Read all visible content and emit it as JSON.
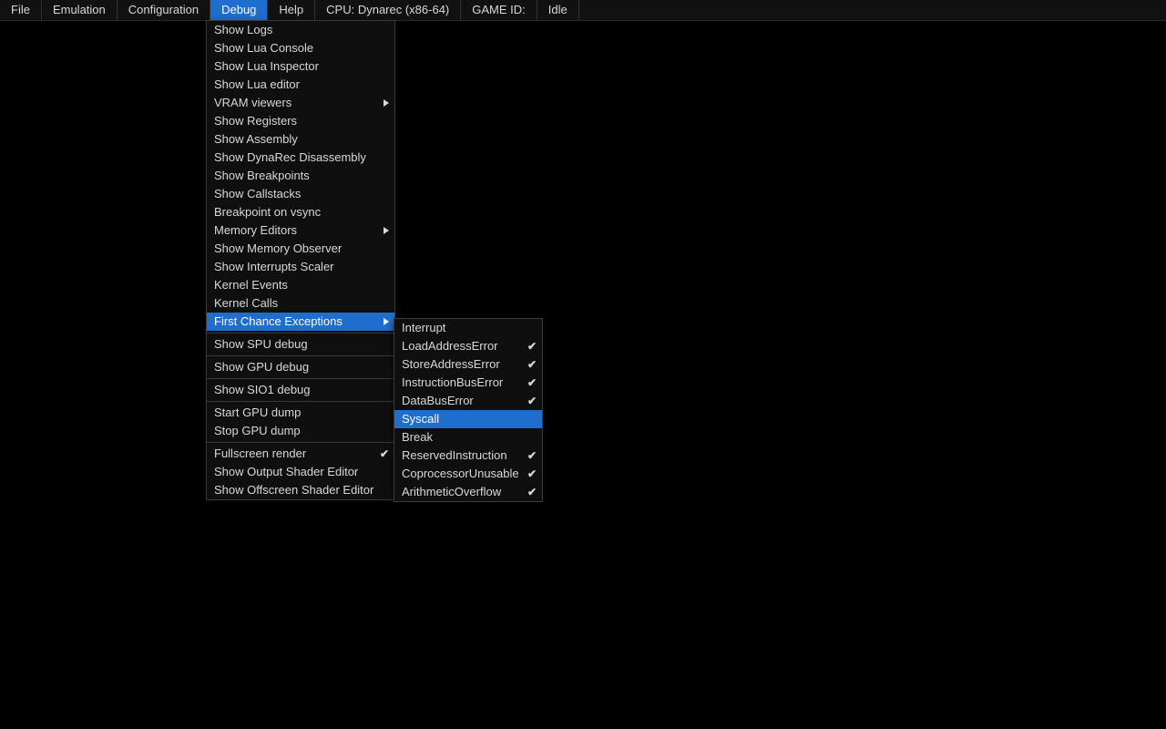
{
  "menubar": {
    "file": "File",
    "emulation": "Emulation",
    "configuration": "Configuration",
    "debug": "Debug",
    "help": "Help",
    "cpu_status": "CPU: Dynarec (x86-64)",
    "game_id_label": "GAME ID:",
    "idle_status": "Idle"
  },
  "debug_menu": {
    "groups": [
      [
        {
          "label": "Show Logs"
        },
        {
          "label": "Show Lua Console"
        },
        {
          "label": "Show Lua Inspector"
        },
        {
          "label": "Show Lua editor"
        },
        {
          "label": "VRAM viewers",
          "submenu": true
        },
        {
          "label": "Show Registers"
        },
        {
          "label": "Show Assembly"
        },
        {
          "label": "Show DynaRec Disassembly"
        },
        {
          "label": "Show Breakpoints"
        },
        {
          "label": "Show Callstacks"
        },
        {
          "label": "Breakpoint on vsync"
        },
        {
          "label": "Memory Editors",
          "submenu": true
        },
        {
          "label": "Show Memory Observer"
        },
        {
          "label": "Show Interrupts Scaler"
        },
        {
          "label": "Kernel Events"
        },
        {
          "label": "Kernel Calls"
        },
        {
          "label": "First Chance Exceptions",
          "submenu": true,
          "highlight": true
        }
      ],
      [
        {
          "label": "Show SPU debug"
        }
      ],
      [
        {
          "label": "Show GPU debug"
        }
      ],
      [
        {
          "label": "Show SIO1 debug"
        }
      ],
      [
        {
          "label": "Start GPU dump"
        },
        {
          "label": "Stop GPU dump"
        }
      ],
      [
        {
          "label": "Fullscreen render",
          "checked": true
        },
        {
          "label": "Show Output Shader Editor"
        },
        {
          "label": "Show Offscreen Shader Editor"
        }
      ]
    ]
  },
  "submenu": {
    "items": [
      {
        "label": "Interrupt"
      },
      {
        "label": "LoadAddressError",
        "checked": true
      },
      {
        "label": "StoreAddressError",
        "checked": true
      },
      {
        "label": "InstructionBusError",
        "checked": true
      },
      {
        "label": "DataBusError",
        "checked": true
      },
      {
        "label": "Syscall",
        "highlight": true
      },
      {
        "label": "Break"
      },
      {
        "label": "ReservedInstruction",
        "checked": true
      },
      {
        "label": "CoprocessorUnusable",
        "checked": true
      },
      {
        "label": "ArithmeticOverflow",
        "checked": true
      }
    ]
  }
}
